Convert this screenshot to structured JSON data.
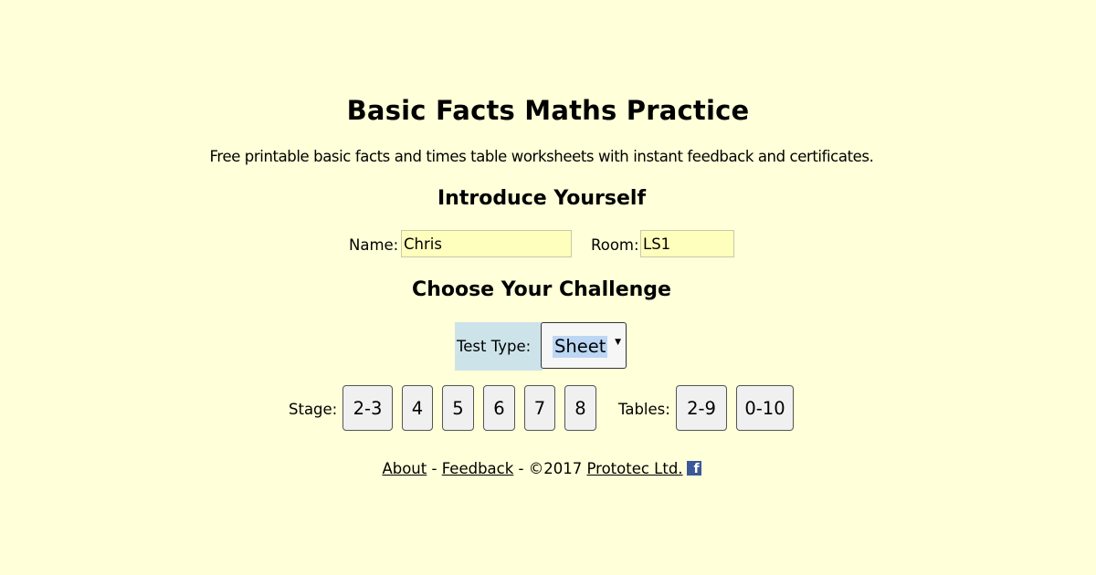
{
  "header": {
    "title": "Basic Facts Maths Practice",
    "subtitle": "Free printable basic facts and times table worksheets with instant feedback and certificates."
  },
  "intro": {
    "heading": "Introduce Yourself",
    "name_label": "Name:",
    "name_value": "Chris",
    "room_label": "Room:",
    "room_value": "LS1"
  },
  "challenge": {
    "heading": "Choose Your Challenge",
    "test_type_label": "Test Type:",
    "test_type_selected": "Sheet",
    "stage_label": "Stage:",
    "stages": [
      "2-3",
      "4",
      "5",
      "6",
      "7",
      "8"
    ],
    "tables_label": "Tables:",
    "tables": [
      "2-9",
      "0-10"
    ]
  },
  "footer": {
    "about": "About",
    "sep1": " - ",
    "feedback": "Feedback",
    "sep2": " - ",
    "copyright": "©2017 ",
    "company": "Prototec Ltd.",
    "facebook_icon": "facebook-icon",
    "facebook_letter": "f"
  },
  "colors": {
    "background": "#ffffd9",
    "input_background": "#ffffbd",
    "test_type_highlight": "#cde3ea",
    "selected_text_highlight": "#bcd7f4",
    "facebook_blue": "#3b5998"
  }
}
